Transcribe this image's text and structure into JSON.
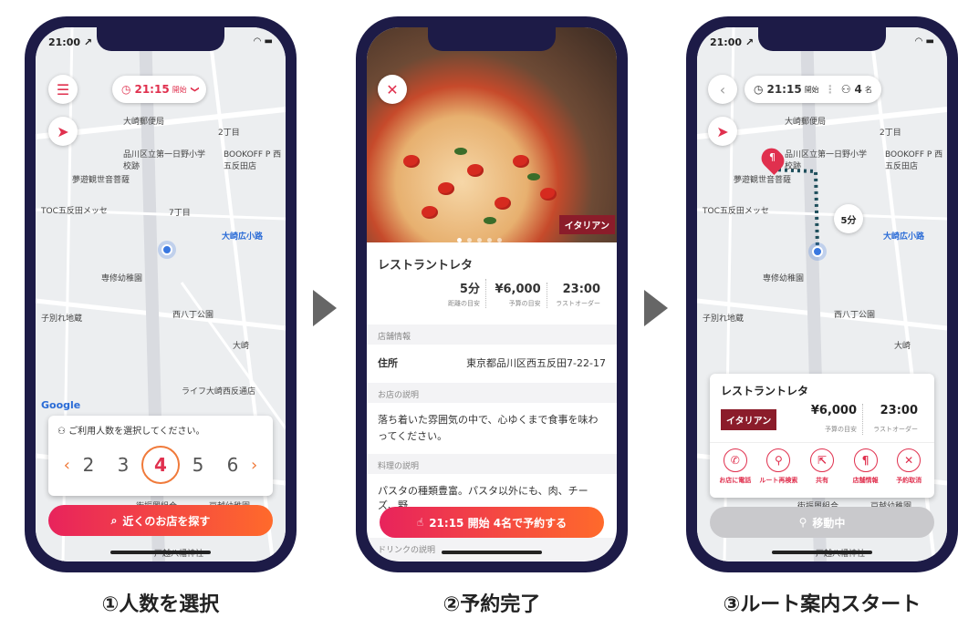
{
  "colors": {
    "accent": "#e0304e",
    "gradient_start": "#e8235c",
    "gradient_end": "#ff6a2b",
    "frame": "#1d1b47",
    "tag": "#8b1c2a"
  },
  "captions": [
    "①人数を選択",
    "②予約完了",
    "③ルート案内スタート"
  ],
  "phone1": {
    "status_time": "21:00 ↗",
    "menu_icon": "hamburger-icon",
    "time_pill": {
      "time": "21:15",
      "suffix": "開始",
      "chevron": "❯"
    },
    "map_labels": [
      "大崎郵便局",
      "2丁目",
      "品川区立第一日野小学校跡",
      "BOOKOFF P 西五反田店",
      "夢遊観世音菩薩",
      "TOC五反田メッセ",
      "7丁目",
      "大崎広小路",
      "専修幼稚園",
      "子別れ地蔵",
      "西八丁公園",
      "大崎",
      "ライフ大崎西反通店",
      "街振興組合",
      "戸越幼稚園",
      "戸越八幡神社",
      "Google"
    ],
    "count_prompt": "ご利用人数を選択してください。",
    "counts": [
      "2",
      "3",
      "4",
      "5",
      "6"
    ],
    "selected_count": "4",
    "prev": "‹",
    "next": "›",
    "cta": "近くのお店を探す"
  },
  "phone2": {
    "close": "✕",
    "tag": "イタリアン",
    "name": "レストラントレタ",
    "metrics": [
      {
        "value": "5分",
        "label": "距離の目安"
      },
      {
        "value": "¥6,000",
        "label": "予算の目安"
      },
      {
        "value": "23:00",
        "label": "ラストオーダー"
      }
    ],
    "sec_info": "店舗情報",
    "address_label": "住所",
    "address": "東京都品川区西五反田7-22-17",
    "sec_desc": "お店の説明",
    "desc": "落ち着いた雰囲気の中で、心ゆくまで食事を味わってください。",
    "sec_food": "料理の説明",
    "food": "パスタの種類豊富。パスタ以外にも、肉、チーズ、野",
    "sec_drink": "ドリンクの説明",
    "cta": "21:15 開始 4名で予約する"
  },
  "phone3": {
    "status_time": "21:00 ↗",
    "back": "‹",
    "time": "21:15",
    "time_suffix": "開始",
    "people": "4",
    "people_suffix": "名",
    "duration": "5分",
    "map_labels": [
      "大崎郵便局",
      "2丁目",
      "品川区立第一日野小学校跡",
      "BOOKOFF P 西五反田店",
      "夢遊観世音菩薩",
      "TOC五反田メッセ",
      "大崎広小路",
      "専修幼稚園",
      "子別れ地蔵",
      "西八丁公園",
      "大崎",
      "街振興組合",
      "戸越幼稚園",
      "戸越八幡神社"
    ],
    "shop_name": "レストラントレタ",
    "tag": "イタリアン",
    "budget": "¥6,000",
    "budget_label": "予算の目安",
    "last": "23:00",
    "last_label": "ラストオーダー",
    "actions": [
      {
        "icon": "phone-icon",
        "glyph": "✆",
        "label": "お店に電話"
      },
      {
        "icon": "route-icon",
        "glyph": "⚲",
        "label": "ルート再検索"
      },
      {
        "icon": "share-icon",
        "glyph": "⇱",
        "label": "共有"
      },
      {
        "icon": "cutlery-icon",
        "glyph": "¶",
        "label": "店舗情報"
      },
      {
        "icon": "cancel-icon",
        "glyph": "✕",
        "label": "予約取消"
      }
    ],
    "moving": "移動中"
  }
}
